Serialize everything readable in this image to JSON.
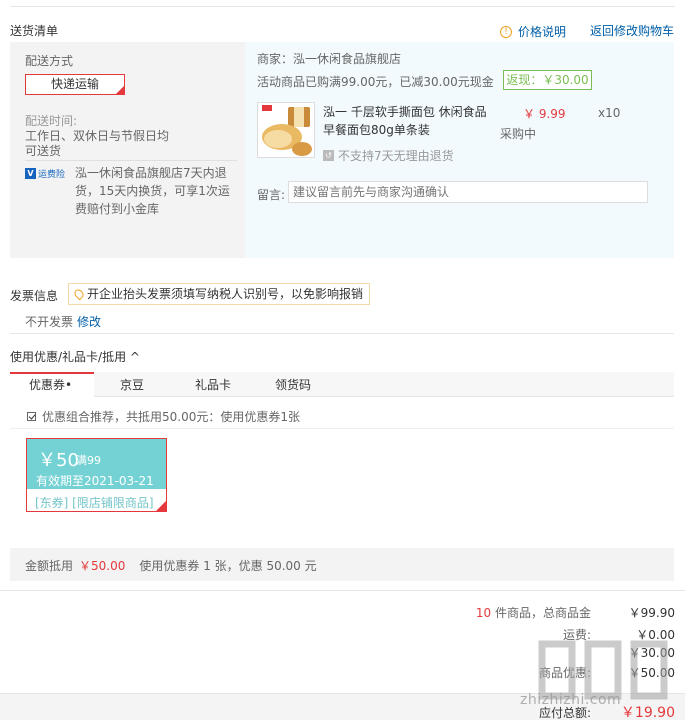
{
  "delivery": {
    "section_title": "送货清单",
    "price_note": "价格说明",
    "back_to_cart": "返回修改购物车",
    "ship_method_label": "配送方式",
    "ship_method_value": "快递运输",
    "ship_time_label": "配送时间:",
    "ship_time_line1": "工作日、双休日与节假日均",
    "ship_time_line2": "可送货",
    "insurance_badge": "运费险",
    "insurance_text": "泓一休闲食品旗舰店7天内退货，15天内换货，可享1次运费赔付到小金库"
  },
  "order": {
    "merchant": "商家：泓一休闲食品旗舰店",
    "promo": "活动商品已购满99.00元，已减30.00元现金",
    "rebate": "返现：￥30.00",
    "product_name": "泓一 千层软手撕面包 休闲食品早餐面包80g单条装",
    "price": "￥ 9.99",
    "qty": "x10",
    "stock": "采购中",
    "no_return": "不支持7天无理由退货",
    "message_label": "留言:",
    "message_placeholder": "建议留言前先与商家沟通确认"
  },
  "invoice": {
    "title": "发票信息",
    "tip": "开企业抬头发票须填写纳税人识别号，以免影响报销",
    "status": "不开发票",
    "edit": "修改"
  },
  "coupons": {
    "title": "使用优惠/礼品卡/抵用 ^",
    "tabs": [
      "优惠券•",
      "京豆",
      "礼品卡",
      "领货码"
    ],
    "combo_text": "优惠组合推荐，共抵用50.00元：使用优惠券1张",
    "coupon": {
      "amount": "￥50",
      "condition": "满99",
      "valid": "有效期至2021-03-21",
      "type": "[东券] [限店铺限商品]"
    },
    "footer_label": "金额抵用",
    "footer_amount": "￥50.00",
    "footer_text": "使用优惠券 1 张，优惠 50.00 元"
  },
  "summary": {
    "count": "10",
    "count_suffix": "件商品，总商品金",
    "total": "￥99.90",
    "freight_label": "运费:",
    "freight": "￥0.00",
    "rebate_val": "￥30.00",
    "coupon_label": "商品优惠:",
    "coupon_val": "￥50.00",
    "pay_label": "应付总额:",
    "pay_val": "￥19.90"
  },
  "watermark": "zhizhizhi.com",
  "colors": {
    "accent": "#e4393c",
    "link": "#005ea7",
    "coupon": "#74d2d4",
    "rebate": "#7abd54"
  }
}
